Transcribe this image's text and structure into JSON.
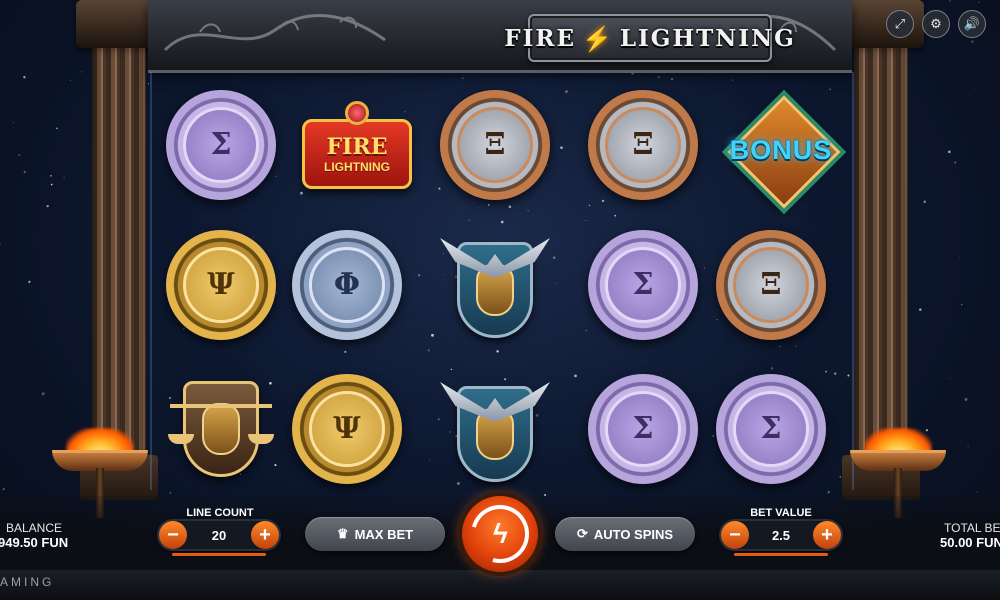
{
  "game": {
    "logo_left": "FIRE",
    "logo_right": "LIGHTNING",
    "brand_fragment": "AMING"
  },
  "top_icons": [
    {
      "name": "fullscreen-icon",
      "glyph": "⤢"
    },
    {
      "name": "settings-icon",
      "glyph": "⚙"
    },
    {
      "name": "sound-icon",
      "glyph": "🔊"
    }
  ],
  "reels": {
    "rows": 3,
    "columns": 5,
    "grid": [
      [
        "sigma-purple",
        "fire-lightning",
        "xi-bronze",
        "xi-bronze",
        "bonus"
      ],
      [
        "psi-gold",
        "phi-silver",
        "winged-helm",
        "sigma-purple",
        "xi-bronze"
      ],
      [
        "justice",
        "psi-gold",
        "winged-helm",
        "sigma-purple",
        "sigma-purple"
      ]
    ],
    "glyphs": {
      "sigma": "Σ",
      "xi": "Ξ",
      "psi": "Ψ",
      "phi": "Φ"
    },
    "bonus_text": "BONUS",
    "fire_lightning_top": "FIRE",
    "fire_lightning_bottom": "LIGHTNING"
  },
  "footer": {
    "balance_label": "BALANCE",
    "balance_value": "949.50 FUN",
    "line_count_label": "LINE COUNT",
    "line_count_value": "20",
    "max_bet_label": "MAX BET",
    "auto_spins_label": "AUTO SPINS",
    "bet_value_label": "BET VALUE",
    "bet_value": "2.5",
    "total_bet_label": "TOTAL BET",
    "total_bet_value": "50.00 FUN",
    "minus": "−",
    "plus": "+"
  },
  "colors": {
    "accent_orange": "#e65a0f",
    "bonus_blue": "#3fd3ff",
    "panel_gray": "#41454c"
  }
}
